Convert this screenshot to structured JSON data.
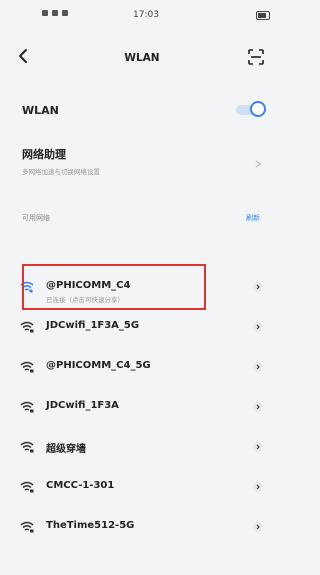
{
  "status_bar": {
    "time": "17:03"
  },
  "nav": {
    "title": "WLAN"
  },
  "wlan_toggle": {
    "label": "WLAN",
    "state": "on"
  },
  "assistant": {
    "title": "网络助理",
    "description": "多网络加速与切换网络设置"
  },
  "available": {
    "header": "可用网络",
    "refresh": "刷新"
  },
  "networks": [
    {
      "name": "@PHICOMM_C4",
      "status": "已连接（点击可快速分享）",
      "connected": true
    },
    {
      "name": "JDCwifi_1F3A_5G",
      "status": "",
      "connected": false
    },
    {
      "name": "@PHICOMM_C4_5G",
      "status": "",
      "connected": false
    },
    {
      "name": "JDCwifi_1F3A",
      "status": "",
      "connected": false
    },
    {
      "name": "超级穿墙",
      "status": "",
      "connected": false
    },
    {
      "name": "CMCC-1-301",
      "status": "",
      "connected": false
    },
    {
      "name": "TheTime512-5G",
      "status": "",
      "connected": false
    }
  ],
  "colors": {
    "accent": "#3b82f6",
    "highlight": "#e0322e"
  }
}
